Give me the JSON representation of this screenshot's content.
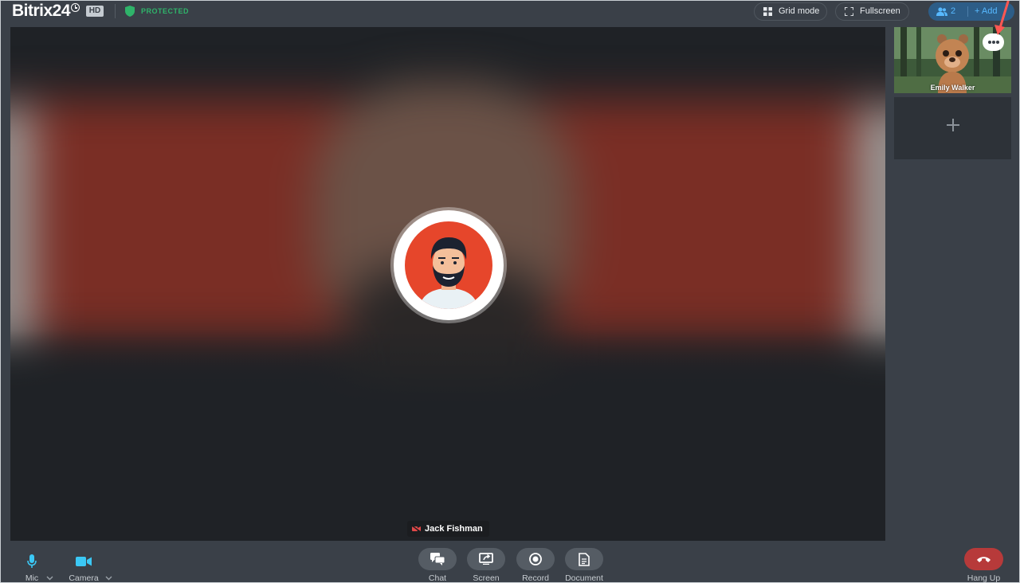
{
  "header": {
    "logo": "Bitrix24",
    "quality_badge": "HD",
    "security_label": "PROTECTED",
    "grid_mode_label": "Grid mode",
    "fullscreen_label": "Fullscreen",
    "participants_count": "2",
    "add_label": "+ Add"
  },
  "main": {
    "speaker_name": "Jack Fishman"
  },
  "sidebar": {
    "participant_name": "Emily Walker"
  },
  "toolbar": {
    "mic_label": "Mic",
    "camera_label": "Camera",
    "chat_label": "Chat",
    "screen_label": "Screen",
    "record_label": "Record",
    "document_label": "Document",
    "hangup_label": "Hang Up"
  },
  "colors": {
    "accent_blue": "#3bc8f5",
    "protected_green": "#2fb36a",
    "hangup_red": "#b73a3a",
    "annotation_arrow": "#ff5752"
  }
}
